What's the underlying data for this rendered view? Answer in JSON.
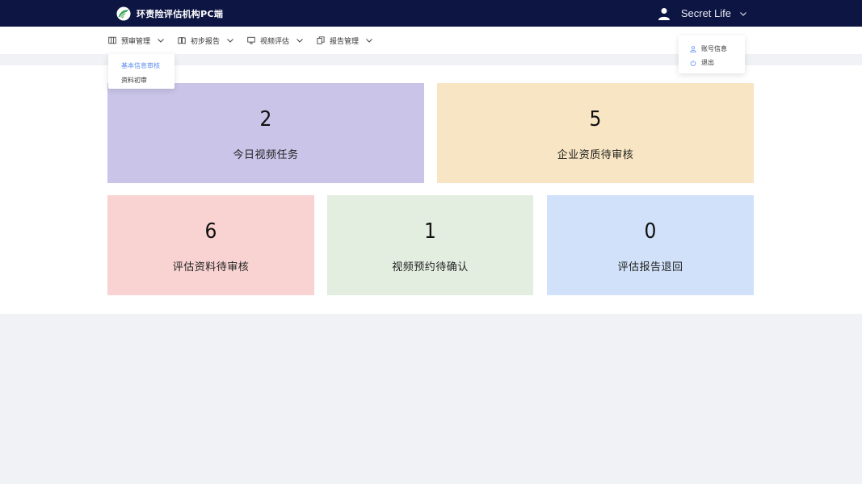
{
  "header": {
    "app_title": "环责险评估机构PC端",
    "logo_icon": "leaf-logo-icon",
    "user_name": "Secret Life",
    "bg_color": "#0d1543"
  },
  "nav": {
    "items": [
      {
        "label": "预审管理",
        "icon": "columns-icon"
      },
      {
        "label": "初步报告",
        "icon": "book-icon"
      },
      {
        "label": "视频评估",
        "icon": "monitor-icon"
      },
      {
        "label": "报告管理",
        "icon": "copy-icon"
      }
    ],
    "open_menu": {
      "items": [
        {
          "label": "基本信息审核",
          "active": true
        },
        {
          "label": "资料初审",
          "active": false
        }
      ]
    }
  },
  "user_menu": {
    "items": [
      {
        "label": "账号信息",
        "icon": "user-icon"
      },
      {
        "label": "退出",
        "icon": "power-icon"
      }
    ]
  },
  "stats": [
    {
      "value": "2",
      "label": "今日视频任务",
      "color": "#c9c4e8"
    },
    {
      "value": "5",
      "label": "企业资质待审核",
      "color": "#f8e5c3"
    },
    {
      "value": "6",
      "label": "评估资料待审核",
      "color": "#f8d3d2"
    },
    {
      "value": "1",
      "label": "视频预约待确认",
      "color": "#e3ede0"
    },
    {
      "value": "0",
      "label": "评估报告退回",
      "color": "#d0e1f9"
    }
  ],
  "accent_color": "#5b8def"
}
